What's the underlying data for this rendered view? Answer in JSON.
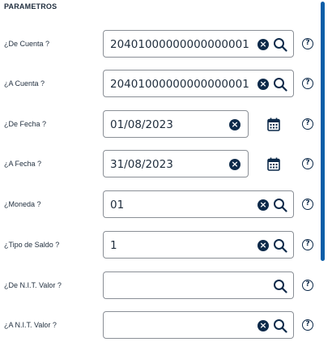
{
  "section": {
    "title": "PARAMETROS"
  },
  "fields": [
    {
      "label": "¿De Cuenta ?",
      "value": "20401000000000000001",
      "clear_icon": "×",
      "help_icon": "?"
    },
    {
      "label": "¿A Cuenta ?",
      "value": "20401000000000000001",
      "clear_icon": "×",
      "help_icon": "?"
    },
    {
      "label": "¿De Fecha ?",
      "value": "01/08/2023",
      "clear_icon": "×",
      "help_icon": "?"
    },
    {
      "label": "¿A Fecha ?",
      "value": "31/08/2023",
      "clear_icon": "×",
      "help_icon": "?"
    },
    {
      "label": "¿Moneda ?",
      "value": "01",
      "clear_icon": "×",
      "help_icon": "?"
    },
    {
      "label": "¿Tipo de Saldo ?",
      "value": "1",
      "clear_icon": "×",
      "help_icon": "?"
    },
    {
      "label": "¿De N.I.T. Valor ?",
      "value": "",
      "help_icon": "?"
    },
    {
      "label": "¿A N.I.T. Valor ?",
      "value": "",
      "clear_icon": "×",
      "help_icon": "?"
    }
  ],
  "colors": {
    "accent": "#0b5ea8",
    "icon": "#0d2a4a",
    "border": "#8a8f96",
    "text": "#1f2d3d"
  },
  "icons": [
    "clear-icon",
    "search-icon",
    "calendar-icon",
    "help-icon"
  ]
}
